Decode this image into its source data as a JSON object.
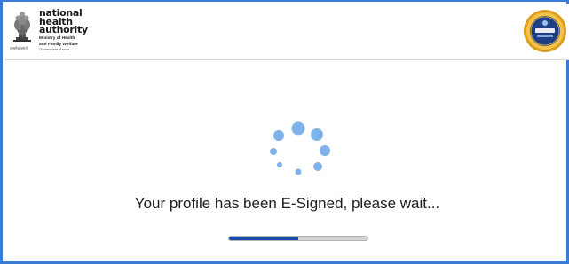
{
  "header": {
    "brand_lines": [
      "national",
      "health",
      "authority"
    ],
    "ministry_lines": [
      "Ministry of Health",
      "and Family Welfare"
    ],
    "government": "Government of India",
    "emblem_caption": "सत्यमेव जयते",
    "left_logo_icon": "national-emblem-icon",
    "right_logo_icon": "cdac-seal-icon"
  },
  "main": {
    "status_message": "Your profile has been E-Signed, please wait...",
    "spinner_icon": "loading-dots-icon",
    "progress": 0.5
  },
  "colors": {
    "frame_border": "#3b7bd8",
    "spinner_dot": "#7fb2ea",
    "progress_fill": "#1f4ba8",
    "progress_track": "#d4d4d4",
    "seal_gold": "#e0a21f",
    "seal_navy": "#1f3f85"
  }
}
